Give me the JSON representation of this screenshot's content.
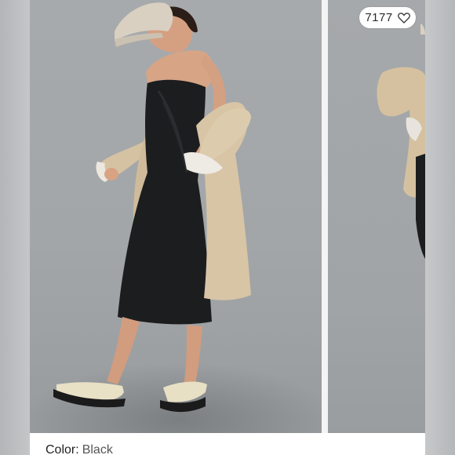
{
  "listing": {
    "like_count": "7177",
    "color_label": "Color:",
    "color_value": "Black"
  },
  "icons": {
    "like": "heart-outline-icon"
  },
  "colors": {
    "backdrop": "#a4a8aa",
    "dress": "#1c1d1f",
    "coat": "#d6c3a5",
    "cap": "#d9d0c2",
    "sandal": "#eae2c8"
  }
}
